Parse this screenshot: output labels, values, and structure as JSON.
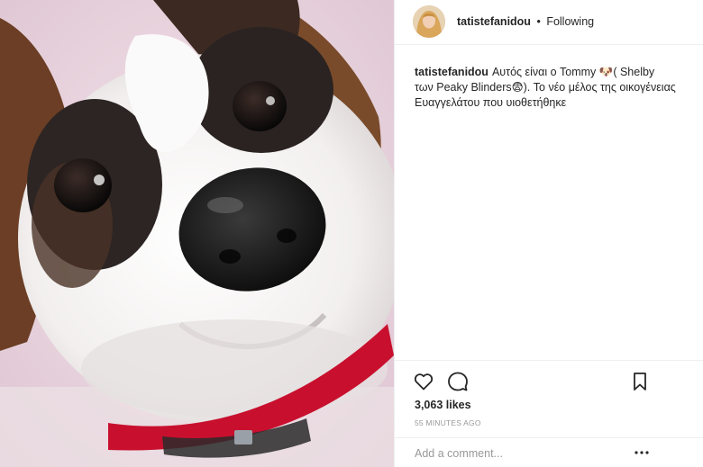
{
  "post": {
    "username": "tatistefanidou",
    "separator": "•",
    "follow_state": "Following",
    "caption_user": "tatistefanidou",
    "caption_text": "Αυτός είναι ο Tommy 🐶( Shelby των Peaky Blinders😨). Το νέο μέλος της οικογένειας Ευαγγελάτου που υιοθετήθηκε",
    "likes": "3,063 likes",
    "timestamp": "55 MINUTES AGO",
    "comment_placeholder": "Add a comment..."
  },
  "photo": {
    "subject": "dog-closeup",
    "background_color": "#e9d2db",
    "collar_color": "#c8102e"
  },
  "icons": {
    "like": "heart-icon",
    "comment": "speech-bubble-icon",
    "save": "bookmark-icon",
    "more": "more-options-icon"
  }
}
